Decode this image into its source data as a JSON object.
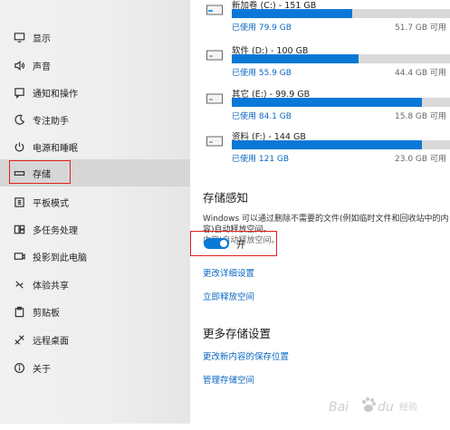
{
  "sidebar": {
    "items": [
      {
        "label": "显示",
        "icon": "monitor-icon"
      },
      {
        "label": "声音",
        "icon": "speaker-icon"
      },
      {
        "label": "通知和操作",
        "icon": "notification-icon"
      },
      {
        "label": "专注助手",
        "icon": "moon-icon"
      },
      {
        "label": "电源和睡眠",
        "icon": "power-icon"
      },
      {
        "label": "存储",
        "icon": "storage-icon",
        "selected": true
      },
      {
        "label": "平板模式",
        "icon": "tablet-icon"
      },
      {
        "label": "多任务处理",
        "icon": "multitask-icon"
      },
      {
        "label": "投影到此电脑",
        "icon": "projector-icon"
      },
      {
        "label": "体验共享",
        "icon": "share-icon"
      },
      {
        "label": "剪贴板",
        "icon": "clipboard-icon"
      },
      {
        "label": "远程桌面",
        "icon": "remote-desktop-icon"
      },
      {
        "label": "关于",
        "icon": "info-icon"
      }
    ]
  },
  "drives": [
    {
      "name": "新加卷 (C:) - 151 GB",
      "used": "已使用 79.9 GB",
      "free": "51.7 GB 可用",
      "used_fraction": 0.53
    },
    {
      "name": "软件 (D:) - 100 GB",
      "used": "已使用 55.9 GB",
      "free": "44.4 GB 可用",
      "used_fraction": 0.56
    },
    {
      "name": "其它 (E:) - 99.9 GB",
      "used": "已使用 84.1 GB",
      "free": "15.8 GB 可用",
      "used_fraction": 0.84
    },
    {
      "name": "资料 (F:) - 144 GB",
      "used": "已使用 121 GB",
      "free": "23.0 GB 可用",
      "used_fraction": 0.84
    }
  ],
  "storage_sense": {
    "title": "存储感知",
    "description_line1": "Windows 可以通过删除不需要的文件(例如临时文件和回收站中的内容)自动释放空间。",
    "description_line2": "内容)自动释放空间。",
    "toggle_label": "开",
    "toggle_on": true,
    "link_change": "更改详细设置",
    "link_free": "立即释放空间"
  },
  "more_settings": {
    "title": "更多存储设置",
    "link_save_location": "更改新内容的保存位置",
    "link_manage": "管理存储空间"
  },
  "colors": {
    "accent": "#0a78d7",
    "link": "#0a66c2",
    "highlight_box": "#e0201f"
  },
  "watermark": {
    "text": "Bai du 经验",
    "icon": "baidu-paw-icon"
  }
}
